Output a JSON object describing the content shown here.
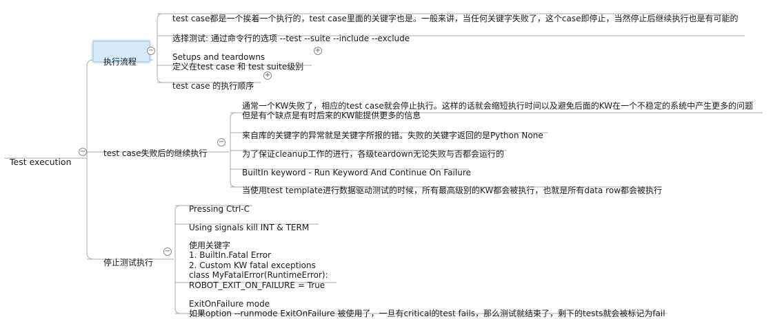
{
  "root": {
    "label": "Test execution",
    "toggle": "−"
  },
  "branches": [
    {
      "label": "执行流程",
      "toggle": "−",
      "children": [
        {
          "text": "test case都是一个挨着一个执行的，test case里面的关键字也是。一般来讲，当任何关键字失败了，这个case即停止，当然停止后继续执行也是有可能的"
        },
        {
          "text": "选择测试: 通过命令行的选项 --test --suite --include --exclude"
        },
        {
          "text": "Setups and teardowns\n定义在test case 和  test suite级别",
          "toggle": "+"
        },
        {
          "text": "test case 的执行顺序",
          "toggle": "+"
        }
      ]
    },
    {
      "label": "test case失败后的继续执行",
      "toggle": "−",
      "children": [
        {
          "text": "通常一个KW失败了，相应的test case就会停止执行。这样的话就会缩短执行时间以及避免后面的KW在一个不稳定的系统中产生更多的问题\n但是有个缺点是有时后来的KW能提供更多的信息"
        },
        {
          "text": "来自库的关键字的异常就是关键字所报的错。失败的关键字返回的是Python None"
        },
        {
          "text": "为了保证cleanup工作的进行，各级teardown无论失败与否都会运行的"
        },
        {
          "text": "BuiltIn keyword - Run Keyword And Continue On Failure"
        },
        {
          "text": "当使用test template进行数据驱动测试的时候，所有最高级别的KW都会被执行，也就是所有data row都会被执行"
        }
      ]
    },
    {
      "label": "停止测试执行",
      "toggle": "−",
      "children": [
        {
          "text": "Pressing Ctrl-C"
        },
        {
          "text": "Using signals   kill  INT & TERM"
        },
        {
          "text": "使用关键字\n1. BuiltIn.Fatal Error\n2. Custom KW  fatal exceptions\nclass MyFatalError(RuntimeError):\n    ROBOT_EXIT_ON_FAILURE = True"
        },
        {
          "text": "ExitOnFailure mode\n如果option --runmode  ExitOnFailure 被使用了，一旦有critical的test fails，那么测试就结束了，剩下的tests就会被标记为fail"
        }
      ]
    }
  ],
  "colors": {
    "line": "#aaaaaa",
    "selected_fill": "#d5e9f7",
    "selected_border": "#b7d7ee",
    "text": "#1a1a1a"
  }
}
